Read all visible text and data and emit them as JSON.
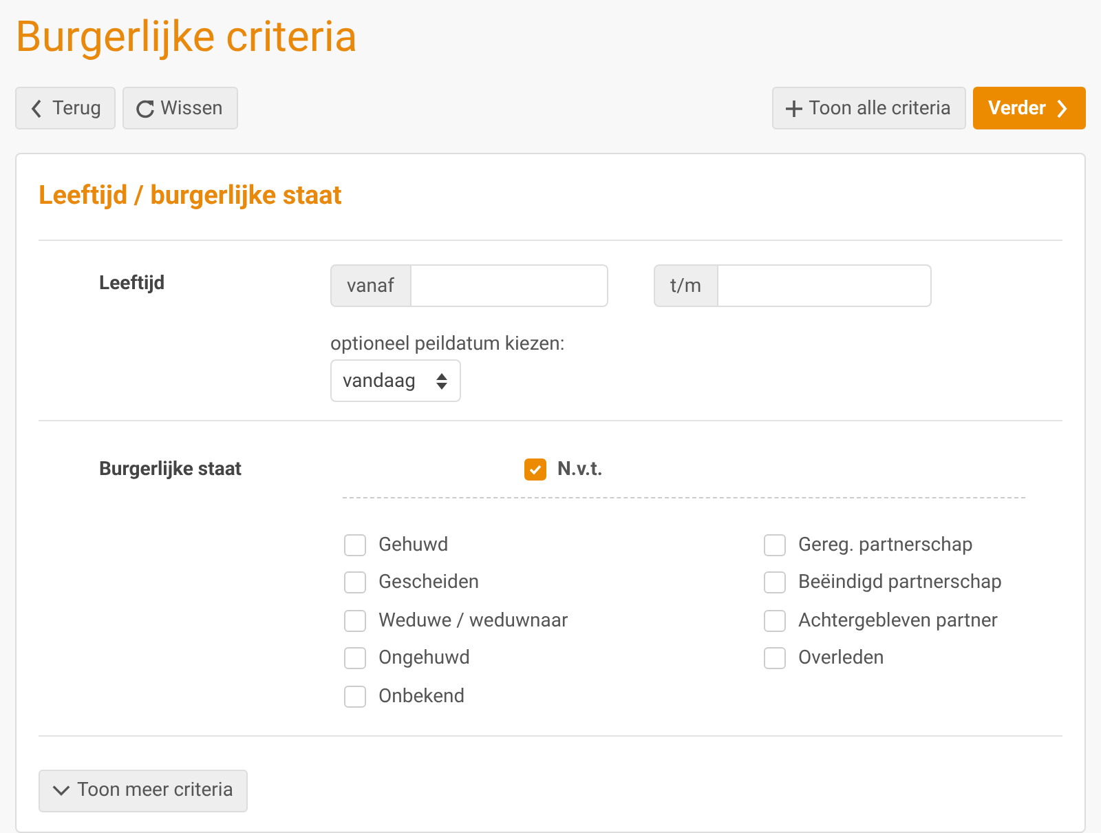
{
  "page_title": "Burgerlijke criteria",
  "toolbar": {
    "left": [
      {
        "label": "Terug",
        "kind": "back"
      },
      {
        "label": "Wissen",
        "kind": "reset"
      }
    ],
    "right": [
      {
        "label": "Toon alle criteria",
        "kind": "add"
      },
      {
        "label": "Verder",
        "kind": "next"
      }
    ]
  },
  "card": {
    "title": "Leeftijd / burgerlijke staat",
    "age": {
      "label": "Leeftijd",
      "from_addon": "vanaf",
      "to_addon": "t/m",
      "date_label": "optioneel peildatum kiezen:",
      "date_value": "vandaag"
    },
    "marital_status": {
      "label": "Burgerlijke staat",
      "none_option": {
        "label": "N.v.t.",
        "checked": true
      },
      "options": [
        {
          "label": "Gehuwd",
          "checked": false
        },
        {
          "label": "Gescheiden",
          "checked": false
        },
        {
          "label": "Weduwe / weduwnaar",
          "checked": false
        },
        {
          "label": "Ongehuwd",
          "checked": false
        },
        {
          "label": "Onbekend",
          "checked": false
        },
        {
          "label": "Gereg. partnerschap",
          "checked": false
        },
        {
          "label": "Beëindigd partnerschap",
          "checked": false
        },
        {
          "label": "Achtergebleven partner",
          "checked": false
        },
        {
          "label": "Overleden",
          "checked": false
        }
      ]
    },
    "more_button": "Toon meer criteria"
  }
}
